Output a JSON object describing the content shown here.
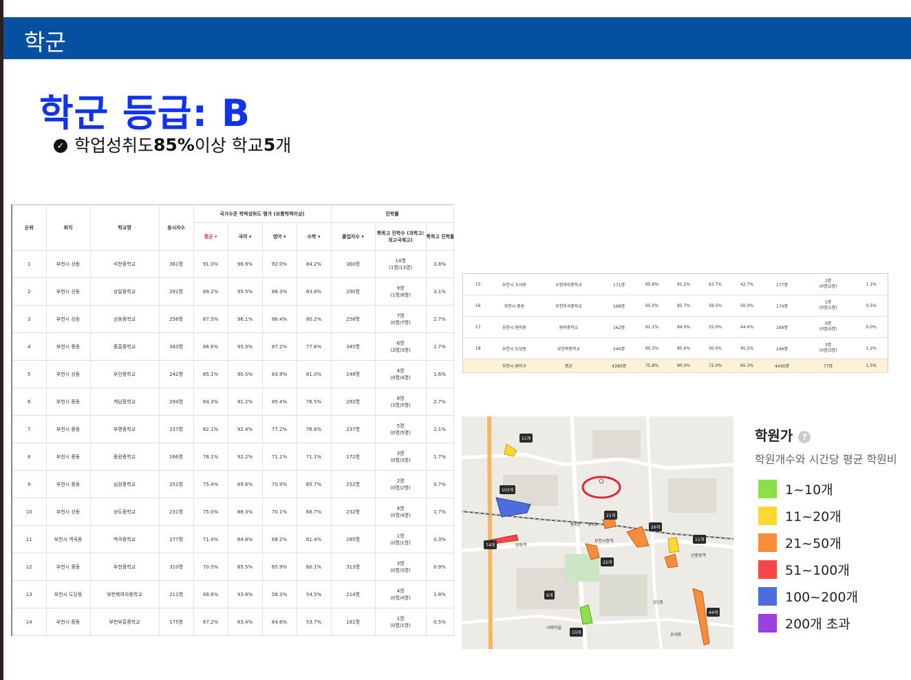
{
  "header": {
    "title": "학군"
  },
  "grade": {
    "label": "학군 등급: B"
  },
  "summary": {
    "pre": "학업성취도 ",
    "bold1": "85%",
    "mid": "이상 학교 ",
    "bold2": "5",
    "post": "개"
  },
  "table1": {
    "group_headers": {
      "achievement": "국가수준 학력성취도 평가 (보통학력이상)",
      "advance": "진학률"
    },
    "columns": [
      "순위",
      "위치",
      "학교명",
      "응시자수",
      "평균 ▾",
      "국어 ▾",
      "영어 ▾",
      "수학 ▾",
      "졸업자수 ▾",
      "특목고 진학수 (과학고/외고국제고)",
      "특목고 진학률 ▾"
    ],
    "rows": [
      [
        "1",
        "부천시 상동",
        "석천중학교",
        "361명",
        "91.0%",
        "96.9%",
        "92.0%",
        "84.2%",
        "360명",
        "14명",
        "(1명/13명)",
        "3.8%"
      ],
      [
        "2",
        "부천시 상동",
        "상일중학교",
        "291명",
        "89.2%",
        "95.5%",
        "88.3%",
        "83.8%",
        "290명",
        "9명",
        "(1명/8명)",
        "3.1%"
      ],
      [
        "3",
        "부천시 상동",
        "상동중학교",
        "256명",
        "87.5%",
        "96.1%",
        "86.4%",
        "80.2%",
        "258명",
        "7명",
        "(0명/7명)",
        "2.7%"
      ],
      [
        "4",
        "부천시 중동",
        "중흥중학교",
        "343명",
        "86.6%",
        "95.0%",
        "87.2%",
        "77.6%",
        "345명",
        "6명",
        "(3명/3명)",
        "1.7%"
      ],
      [
        "5",
        "부천시 상동",
        "부인중학교",
        "242명",
        "85.1%",
        "90.5%",
        "83.9%",
        "81.0%",
        "248명",
        "4명",
        "(0명/4명)",
        "1.6%"
      ],
      [
        "6",
        "부천시 중동",
        "계남중학교",
        "294명",
        "84.3%",
        "91.2%",
        "85.4%",
        "76.5%",
        "292명",
        "8명",
        "(3명/5명)",
        "2.7%"
      ],
      [
        "7",
        "부천시 중동",
        "부명중학교",
        "237명",
        "82.1%",
        "92.4%",
        "77.2%",
        "76.8%",
        "237명",
        "5명",
        "(0명/5명)",
        "2.1%"
      ],
      [
        "8",
        "부천시 중동",
        "중원중학교",
        "166명",
        "78.1%",
        "92.2%",
        "71.1%",
        "71.1%",
        "172명",
        "3명",
        "(0명/3명)",
        "1.7%"
      ],
      [
        "9",
        "부천시 중동",
        "심원중학교",
        "251명",
        "75.4%",
        "89.6%",
        "70.9%",
        "65.7%",
        "252명",
        "2명",
        "(0명/2명)",
        "0.7%"
      ],
      [
        "10",
        "부천시 상동",
        "상도중학교",
        "231명",
        "75.0%",
        "88.3%",
        "70.1%",
        "66.7%",
        "232명",
        "4명",
        "(0명/4명)",
        "1.7%"
      ],
      [
        "11",
        "부천시 역곡동",
        "역곡중학교",
        "277명",
        "71.4%",
        "84.8%",
        "68.2%",
        "61.4%",
        "285명",
        "1명",
        "(0명/1명)",
        "0.3%"
      ],
      [
        "12",
        "부천시 중동",
        "부천중학교",
        "310명",
        "70.5%",
        "85.5%",
        "65.9%",
        "60.1%",
        "313명",
        "3명",
        "(0명/3명)",
        "0.9%"
      ],
      [
        "13",
        "부천시 도당동",
        "부천북여자중학교",
        "211명",
        "68.8%",
        "93.8%",
        "58.3%",
        "54.5%",
        "214명",
        "4명",
        "(0명/4명)",
        "1.8%"
      ],
      [
        "14",
        "부천시 중동",
        "부천부흥중학교",
        "175명",
        "67.2%",
        "83.4%",
        "64.6%",
        "53.7%",
        "181명",
        "1명",
        "(0명/1명)",
        "0.5%"
      ]
    ]
  },
  "table2": {
    "rows": [
      [
        "15",
        "부천시 소사동",
        "소명여자중학교",
        "171명",
        "65.8%",
        "91.2%",
        "63.7%",
        "42.7%",
        "177명",
        "2명",
        "(0명/2명)",
        "1.1%"
      ],
      [
        "16",
        "부천시 중동",
        "부천부곡중학교",
        "168명",
        "65.0%",
        "85.7%",
        "59.5%",
        "50.0%",
        "174명",
        "1명",
        "(0명/1명)",
        "0.5%"
      ],
      [
        "17",
        "부천시 원미동",
        "원미중학교",
        "162명",
        "61.1%",
        "84.0%",
        "55.0%",
        "44.4%",
        "169명",
        "0명",
        "(0명/0명)",
        "0.0%"
      ],
      [
        "18",
        "부천시 도당동",
        "부천복중학교",
        "244명",
        "60.3%",
        "85.6%",
        "50.0%",
        "45.5%",
        "246명",
        "3명",
        "(0명/3명)",
        "1.2%"
      ]
    ],
    "average": [
      "부천시 원미구",
      "평균",
      "4390명",
      "75.8%",
      "90.0%",
      "72.0%",
      "65.3%",
      "4445명",
      "77명",
      "1.5%"
    ]
  },
  "map": {
    "labels": [
      "11개",
      "103개",
      "74개",
      "21개",
      "26개",
      "11개",
      "22개",
      "6개",
      "44개",
      "10개",
      "상동역",
      "부천시청역",
      "신중동역",
      "중3동",
      "중4동",
      "상1동",
      "사랑마을",
      "송내동"
    ]
  },
  "legend": {
    "title": "학원가",
    "subtitle": "학원개수와 시간당 평균 학원비",
    "items": [
      {
        "label": "1~10개",
        "color": "#8ee04a"
      },
      {
        "label": "11~20개",
        "color": "#fdd835"
      },
      {
        "label": "21~50개",
        "color": "#fb8c3c"
      },
      {
        "label": "51~100개",
        "color": "#f44747"
      },
      {
        "label": "100~200개",
        "color": "#4c6de0"
      },
      {
        "label": "200개 초과",
        "color": "#9b3fe0"
      }
    ]
  }
}
